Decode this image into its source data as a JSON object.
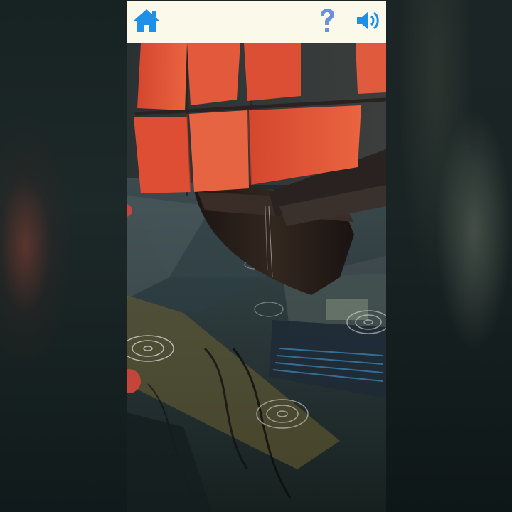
{
  "toolbar": {
    "home_icon": "home-icon",
    "help_icon": "question-mark-icon",
    "sound_icon": "speaker-volume-icon",
    "home_color": "#1e90e8",
    "help_color": "#6d8fe0",
    "sound_color": "#1e90e8",
    "background": "#fbf9ea"
  },
  "scene": {
    "subject": "ar-ship-model",
    "sail_color": "#e0533a",
    "hull_color": "#2a201d"
  }
}
